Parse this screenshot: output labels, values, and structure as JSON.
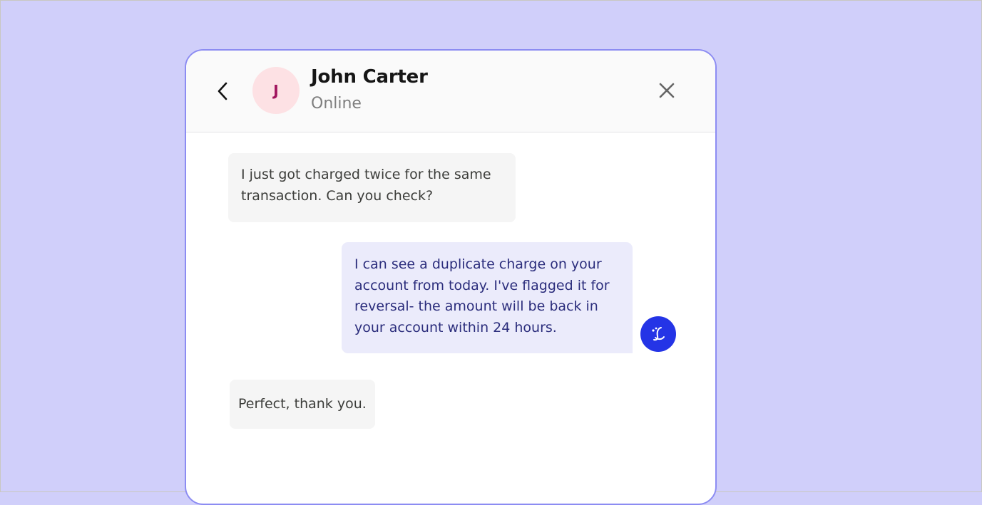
{
  "contact": {
    "name": "John Carter",
    "status": "Online",
    "avatar_initial": "J"
  },
  "messages": [
    {
      "sender": "user",
      "text": "I just got charged twice for the same transaction. Can you check?"
    },
    {
      "sender": "agent",
      "text": "I can see a duplicate charge on your account from today. I've flagged it for reversal- the amount will be back in your account within 24 hours."
    },
    {
      "sender": "user",
      "text": "Perfect, thank you."
    }
  ],
  "icons": {
    "back": "chevron-left-icon",
    "close": "close-icon",
    "agent_avatar": "brand-logo-icon"
  },
  "colors": {
    "page_background": "#d0cffa",
    "window_border": "#8c8cf2",
    "incoming_bubble": "#f5f5f5",
    "outgoing_bubble": "#ebebfb",
    "outgoing_text": "#2b2d7c",
    "agent_avatar": "#2434e6",
    "user_avatar": "#fde1e4",
    "user_avatar_initial": "#a1155e"
  }
}
